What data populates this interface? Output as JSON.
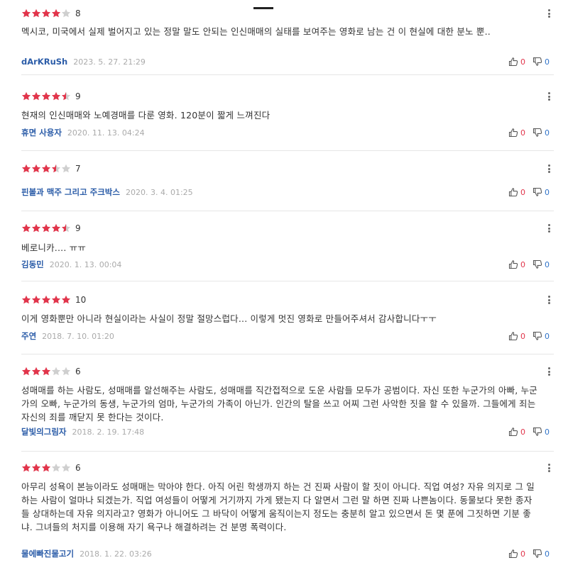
{
  "colors": {
    "star": "#e1354b",
    "star_empty": "#cfcfcf",
    "author": "#2b5ca8",
    "like": "#e1354b",
    "dislike": "#3073c8"
  },
  "reviews": [
    {
      "stars": 4,
      "score": "8",
      "text": "멕시코, 미국에서 실제 벌어지고 있는 정말 말도 안되는 인신매매의 실태를 보여주는 영화로 남는 건 이 현실에 대한 분노 뿐..",
      "author": "dArKRuSh",
      "date": "2023. 5. 27. 21:29",
      "likes": "0",
      "dislikes": "0"
    },
    {
      "stars": 4.5,
      "score": "9",
      "text": "현재의 인신매매와 노예경매를 다룬 영화. 120분이 짧게 느껴진다",
      "author": "휴면 사용자",
      "date": "2020. 11. 13. 04:24",
      "likes": "0",
      "dislikes": "0"
    },
    {
      "stars": 3.5,
      "score": "7",
      "text": "",
      "author": "핀볼과 맥주 그리고 주크박스",
      "date": "2020. 3. 4. 01:25",
      "likes": "0",
      "dislikes": "0"
    },
    {
      "stars": 4.5,
      "score": "9",
      "text": "베로니카.... ㅠㅠ",
      "author": "김동민",
      "date": "2020. 1. 13. 00:04",
      "likes": "0",
      "dislikes": "0"
    },
    {
      "stars": 5,
      "score": "10",
      "text": "이게 영화뿐만 아니라 현실이라는 사실이 정말 절망스럽다... 이렇게 멋진 영화로 만들어주셔서 감사합니다ㅜㅜ",
      "author": "주연",
      "date": "2018. 7. 10. 01:20",
      "likes": "0",
      "dislikes": "0"
    },
    {
      "stars": 3,
      "score": "6",
      "text": "성매매를 하는 사람도, 성매매를 알선해주는 사람도, 성매매를 직간접적으로 도운 사람들 모두가 공범이다. 자신 또한 누군가의 아빠, 누군가의 오빠, 누군가의 동생, 누군가의 엄마, 누군가의 가족이 아닌가. 인간의 탈을 쓰고 어찌 그런 사악한 짓을 할 수 있을까. 그들에게 죄는 자신의 죄를 깨닫지 못 한다는 것이다.",
      "author": "달빛의그림자",
      "date": "2018. 2. 19. 17:48",
      "likes": "0",
      "dislikes": "0"
    },
    {
      "stars": 3,
      "score": "6",
      "text": "아무리 성욕이 본능이라도 성매매는 막아야 한다. 아직 어린 학생까지 하는 건 진짜 사람이 할 짓이 아니다. 직업 여성? 자유 의지로 그 일 하는 사람이 얼마나 되겠는가. 직업 여성들이 어떻게 거기까지 가게 됐는지 다 알면서 그런 말 하면 진짜 나쁜놈이다. 동물보다 못한 종자들 상대하는데 자유 의지라고? 영화가 아니어도 그 바닥이 어떻게 움직이는지 정도는 충분히 알고 있으면서 돈 몇 푼에 그짓하면 기분 좋냐. 그녀들의 처지를 이용해 자기 욕구나 해결하려는 건 분명 폭력이다.",
      "author": "물에빠진물고기",
      "date": "2018. 1. 22. 03:26",
      "likes": "0",
      "dislikes": "0"
    }
  ]
}
